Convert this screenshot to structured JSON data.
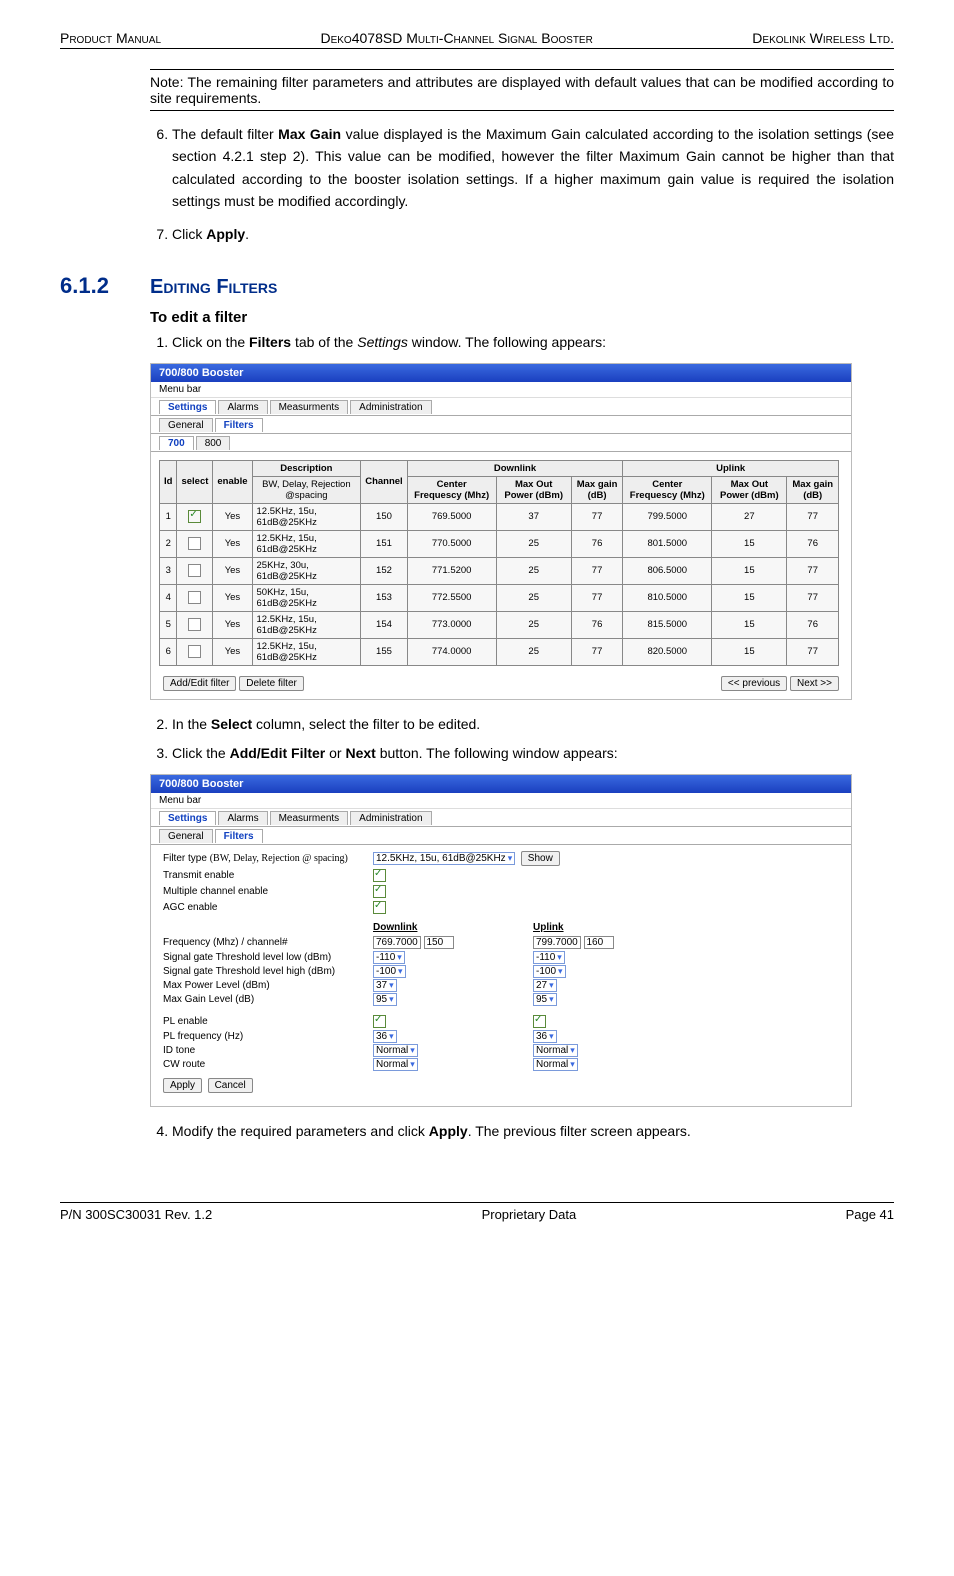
{
  "header": {
    "left": "Product Manual",
    "center": "Deko4078SD Multi-Channel Signal Booster",
    "right": "Dekolink Wireless Ltd."
  },
  "note": "Note: The remaining filter parameters and attributes are displayed with default values that can be modified according to site requirements.",
  "step6": "The default filter Max Gain value displayed is the Maximum Gain calculated according to the isolation settings (see section 4.2.1 step 2). This value can be modified, however the filter Maximum Gain cannot be higher than that calculated according to the booster isolation settings. If a higher maximum gain value is required the isolation settings must be modified accordingly.",
  "step7_pre": "Click ",
  "step7_bold": "Apply",
  "section": {
    "num": "6.1.2",
    "title": "Editing Filters"
  },
  "subtitle": "To edit a filter",
  "sub1_a": "Click on the ",
  "sub1_b": "Filters",
  "sub1_c": " tab of the ",
  "sub1_d": "Settings",
  "sub1_e": " window. The following appears:",
  "sub2_a": "In the ",
  "sub2_b": "Select",
  "sub2_c": " column, select the filter to be edited.",
  "sub3_a": "Click the ",
  "sub3_b": "Add/Edit Filter",
  "sub3_c": " or ",
  "sub3_d": "Next",
  "sub3_e": " button. The following window appears:",
  "sub4_a": "Modify the required parameters and click ",
  "sub4_b": "Apply",
  "sub4_c": ". The previous filter screen appears.",
  "win": {
    "title": "700/800 Booster",
    "menubar": "Menu bar",
    "tabs_top": [
      "Settings",
      "Alarms",
      "Measurments",
      "Administration"
    ],
    "tabs_mid": [
      "General",
      "Filters"
    ],
    "tabs_band": [
      "700",
      "800"
    ]
  },
  "tbl": {
    "head": [
      "Id",
      "select",
      "enable",
      "Description",
      "Channel",
      "Downlink",
      "Uplink"
    ],
    "head_desc": "BW,  Delay, Rejection @spacing",
    "dl_sub": [
      "Center Frequescy (Mhz)",
      "Max Out Power (dBm)",
      "Max gain (dB)"
    ],
    "ul_sub": [
      "Center Frequescy (Mhz)",
      "Max Out Power (dBm)",
      "Max gain (dB)"
    ],
    "rows": [
      {
        "id": "1",
        "sel": true,
        "en": "Yes",
        "desc": "12.5KHz, 15u, 61dB@25KHz",
        "ch": "150",
        "dl": [
          "769.5000",
          "37",
          "77"
        ],
        "ul": [
          "799.5000",
          "27",
          "77"
        ]
      },
      {
        "id": "2",
        "sel": false,
        "en": "Yes",
        "desc": "12.5KHz, 15u, 61dB@25KHz",
        "ch": "151",
        "dl": [
          "770.5000",
          "25",
          "76"
        ],
        "ul": [
          "801.5000",
          "15",
          "76"
        ]
      },
      {
        "id": "3",
        "sel": false,
        "en": "Yes",
        "desc": "25KHz,   30u, 61dB@25KHz",
        "ch": "152",
        "dl": [
          "771.5200",
          "25",
          "77"
        ],
        "ul": [
          "806.5000",
          "15",
          "77"
        ]
      },
      {
        "id": "4",
        "sel": false,
        "en": "Yes",
        "desc": "50KHz,   15u, 61dB@25KHz",
        "ch": "153",
        "dl": [
          "772.5500",
          "25",
          "77"
        ],
        "ul": [
          "810.5000",
          "15",
          "77"
        ]
      },
      {
        "id": "5",
        "sel": false,
        "en": "Yes",
        "desc": "12.5KHz, 15u, 61dB@25KHz",
        "ch": "154",
        "dl": [
          "773.0000",
          "25",
          "76"
        ],
        "ul": [
          "815.5000",
          "15",
          "76"
        ]
      },
      {
        "id": "6",
        "sel": false,
        "en": "Yes",
        "desc": "12.5KHz, 15u, 61dB@25KHz",
        "ch": "155",
        "dl": [
          "774.0000",
          "25",
          "77"
        ],
        "ul": [
          "820.5000",
          "15",
          "77"
        ]
      }
    ],
    "buttons": {
      "add": "Add/Edit filter",
      "del": "Delete filter",
      "prev": "<< previous",
      "next": "Next  >>"
    }
  },
  "form": {
    "filter_type_lbl": "Filter type",
    "filter_type_note": "(BW, Delay, Rejection @ spacing)",
    "filter_type_val": "12.5KHz, 15u, 61dB@25KHz",
    "show": "Show",
    "transmit": "Transmit enable",
    "mce": "Multiple channel enable",
    "agc": "AGC enable",
    "dl": "Downlink",
    "ul": "Uplink",
    "freq_lbl": "Frequency  (Mhz)         / channel#",
    "freq_dl": "769.7000",
    "freq_dl_ch": "150",
    "freq_ul": "799.7000",
    "freq_ul_ch": "160",
    "sg_low": "Signal gate Threshold level low (dBm)",
    "sg_low_dl": "-110",
    "sg_low_ul": "-110",
    "sg_high": "Signal gate Threshold level high (dBm)",
    "sg_high_dl": "-100",
    "sg_high_ul": "-100",
    "max_pwr": "Max Power Level (dBm)",
    "max_pwr_dl": "37",
    "max_pwr_ul": "27",
    "max_gain": "Max Gain Level (dB)",
    "max_gain_dl": "95",
    "max_gain_ul": "95",
    "pl_en": "PL enable",
    "pl_freq": "PL frequency (Hz)",
    "pl_freq_dl": "36",
    "pl_freq_ul": "36",
    "id_tone": "ID tone",
    "id_tone_dl": "Normal",
    "id_tone_ul": "Normal",
    "cw": "CW route",
    "cw_dl": "Normal",
    "cw_ul": "Normal",
    "apply": "Apply",
    "cancel": "Cancel"
  },
  "footer": {
    "left": "P/N 300SC30031 Rev. 1.2",
    "center": "Proprietary Data",
    "right": "Page 41"
  }
}
